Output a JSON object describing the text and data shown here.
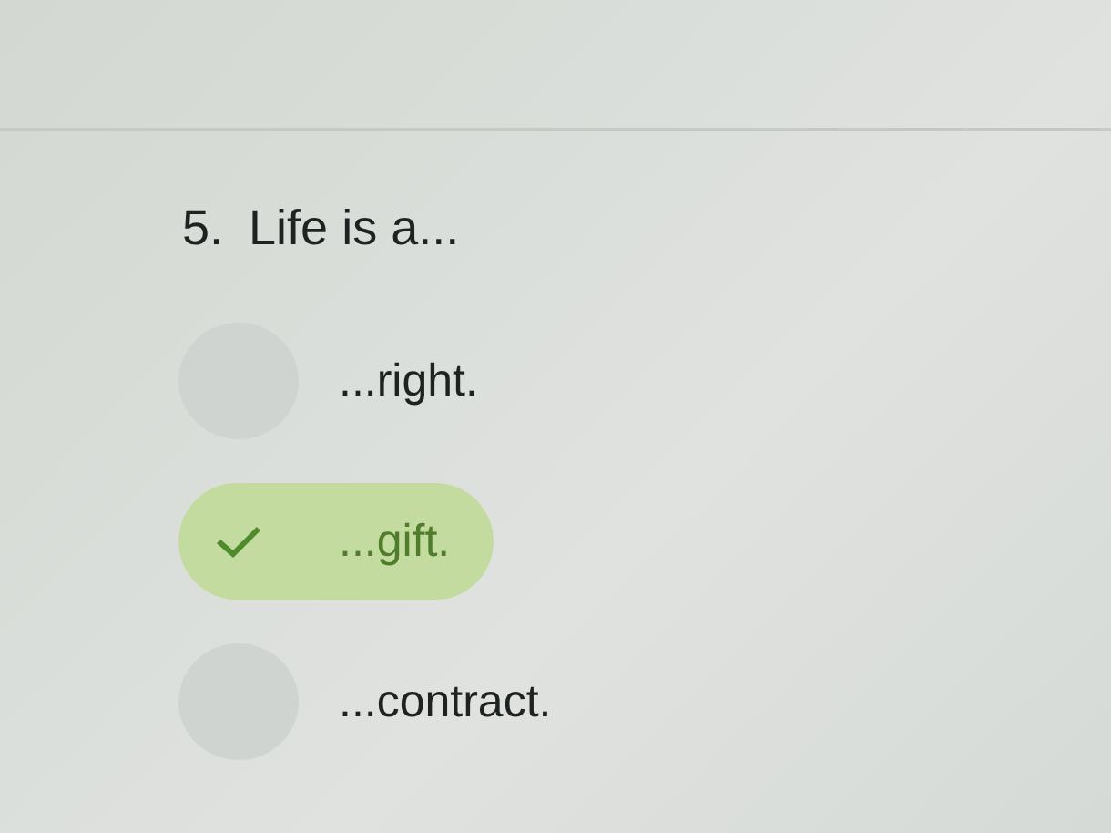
{
  "question": {
    "number": "5.",
    "text": "Life is a..."
  },
  "options": [
    {
      "label": "...right.",
      "selected": false
    },
    {
      "label": "...gift.",
      "selected": true
    },
    {
      "label": "...contract.",
      "selected": false
    }
  ]
}
